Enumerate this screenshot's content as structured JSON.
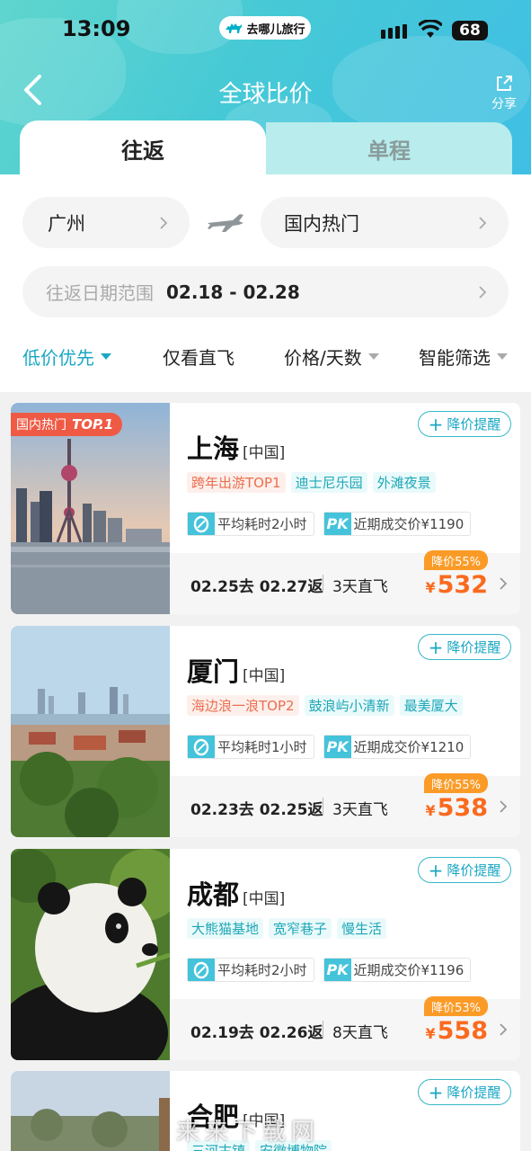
{
  "status": {
    "time": "13:09",
    "app_name": "去哪儿旅行",
    "battery": "68"
  },
  "nav": {
    "title": "全球比价",
    "share_label": "分享"
  },
  "tabs": [
    {
      "label": "往返",
      "active": true
    },
    {
      "label": "单程",
      "active": false
    }
  ],
  "search": {
    "from_city": "广州",
    "to_city": "国内热门",
    "date_label": "往返日期范围",
    "date_value": "02.18 - 02.28"
  },
  "filters": [
    {
      "label": "低价优先",
      "active": true
    },
    {
      "label": "仅看直飞",
      "active": false
    },
    {
      "label": "价格/天数",
      "active": false
    },
    {
      "label": "智能筛选",
      "active": false
    }
  ],
  "colors": {
    "accent": "#1aa7c4",
    "price": "#fa6a1e",
    "discount": "#fb9b27",
    "hot_tag": "#ef5a45"
  },
  "cards": [
    {
      "hot_label": "国内热门",
      "hot_rank": "TOP.1",
      "alert_label": "降价提醒",
      "city": "上海",
      "country": "[中国]",
      "tags": [
        {
          "text": "跨年出游TOP1",
          "style": "red"
        },
        {
          "text": "迪士尼乐园",
          "style": "teal"
        },
        {
          "text": "外滩夜景",
          "style": "teal"
        }
      ],
      "avg_time": "平均耗时2小时",
      "pk_label": "PK",
      "recent_price": "近期成交价¥1190",
      "dates": "02.25去 02.27返",
      "duration": "3天直飞",
      "discount": "降价55%",
      "currency": "¥",
      "price": "532",
      "photo": "shanghai-skyline"
    },
    {
      "alert_label": "降价提醒",
      "city": "厦门",
      "country": "[中国]",
      "tags": [
        {
          "text": "海边浪一浪TOP2",
          "style": "red"
        },
        {
          "text": "鼓浪屿小清新",
          "style": "teal"
        },
        {
          "text": "最美厦大",
          "style": "teal"
        }
      ],
      "avg_time": "平均耗时1小时",
      "pk_label": "PK",
      "recent_price": "近期成交价¥1210",
      "dates": "02.23去 02.25返",
      "duration": "3天直飞",
      "discount": "降价55%",
      "currency": "¥",
      "price": "538",
      "photo": "xiamen-coast"
    },
    {
      "alert_label": "降价提醒",
      "city": "成都",
      "country": "[中国]",
      "tags": [
        {
          "text": "大熊猫基地",
          "style": "teal"
        },
        {
          "text": "宽窄巷子",
          "style": "teal"
        },
        {
          "text": "慢生活",
          "style": "teal"
        }
      ],
      "avg_time": "平均耗时2小时",
      "pk_label": "PK",
      "recent_price": "近期成交价¥1196",
      "dates": "02.19去 02.26返",
      "duration": "8天直飞",
      "discount": "降价53%",
      "currency": "¥",
      "price": "558",
      "photo": "giant-panda"
    },
    {
      "alert_label": "降价提醒",
      "city": "合肥",
      "country": "[中国]",
      "tags": [
        {
          "text": "三河古镇",
          "style": "teal"
        },
        {
          "text": "安徽博物院",
          "style": "teal"
        }
      ],
      "photo": "hefei-pagoda"
    }
  ],
  "watermark": "来来下载网"
}
